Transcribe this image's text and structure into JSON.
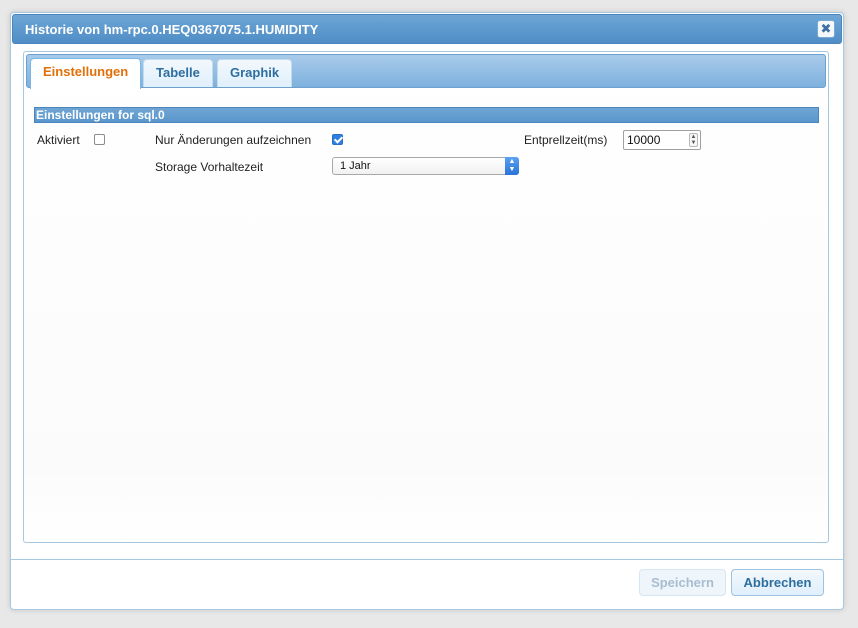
{
  "dialog": {
    "title": "Historie von hm-rpc.0.HEQ0367075.1.HUMIDITY",
    "close_symbol": "✖"
  },
  "tabs": [
    {
      "label": "Einstellungen",
      "active": true
    },
    {
      "label": "Tabelle",
      "active": false
    },
    {
      "label": "Graphik",
      "active": false
    }
  ],
  "settings": {
    "section_title": "Einstellungen for sql.0",
    "enabled_label": "Aktiviert",
    "enabled_checked": false,
    "only_changes_label": "Nur Änderungen aufzeichnen",
    "only_changes_checked": true,
    "debounce_label": "Entprellzeit(ms)",
    "debounce_value": "10000",
    "retention_label": "Storage Vorhaltezeit",
    "retention_value": "1 Jahr"
  },
  "buttons": {
    "save_label": "Speichern",
    "cancel_label": "Abbrechen"
  },
  "icons": {
    "close": "close-icon",
    "spinner": "spinner-arrows-icon",
    "select_arrow": "select-arrows-icon"
  }
}
